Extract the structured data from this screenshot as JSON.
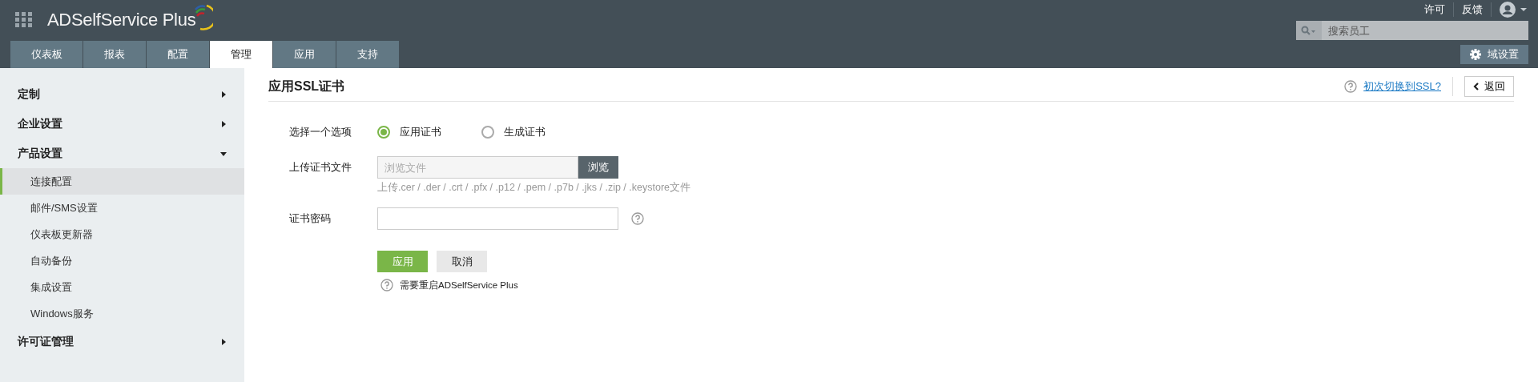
{
  "app": {
    "name": "ADSelfService Plus"
  },
  "header_links": [
    "许可",
    "反馈"
  ],
  "search": {
    "placeholder": "搜索员工"
  },
  "domain_settings_button": "域设置",
  "tabs": [
    {
      "label": "仪表板",
      "selected": false
    },
    {
      "label": "报表",
      "selected": false
    },
    {
      "label": "配置",
      "selected": false
    },
    {
      "label": "管理",
      "selected": true
    },
    {
      "label": "应用",
      "selected": false
    },
    {
      "label": "支持",
      "selected": false
    }
  ],
  "sidebar": {
    "items": [
      {
        "label": "定制",
        "expanded": false
      },
      {
        "label": "企业设置",
        "expanded": false
      },
      {
        "label": "产品设置",
        "expanded": true,
        "children": [
          {
            "label": "连接配置",
            "selected": true
          },
          {
            "label": "邮件/SMS设置",
            "selected": false
          },
          {
            "label": "仪表板更新器",
            "selected": false
          },
          {
            "label": "自动备份",
            "selected": false
          },
          {
            "label": "集成设置",
            "selected": false
          },
          {
            "label": "Windows服务",
            "selected": false
          }
        ]
      },
      {
        "label": "许可证管理",
        "expanded": false
      }
    ]
  },
  "page": {
    "title": "应用SSL证书",
    "help_link": "初次切换到SSL?",
    "back_button": "返回",
    "option_label": "选择一个选项",
    "options": [
      {
        "label": "应用证书",
        "selected": true
      },
      {
        "label": "生成证书",
        "selected": false
      }
    ],
    "upload": {
      "label": "上传证书文件",
      "placeholder": "浏览文件",
      "button": "浏览",
      "hint": "上传.cer / .der / .crt / .pfx / .p12 / .pem / .p7b / .jks / .zip / .keystore文件"
    },
    "password": {
      "label": "证书密码"
    },
    "buttons": [
      {
        "label": "应用",
        "kind": "primary"
      },
      {
        "label": "取消",
        "kind": "secondary"
      }
    ],
    "note": "需要重启ADSelfService Plus"
  }
}
